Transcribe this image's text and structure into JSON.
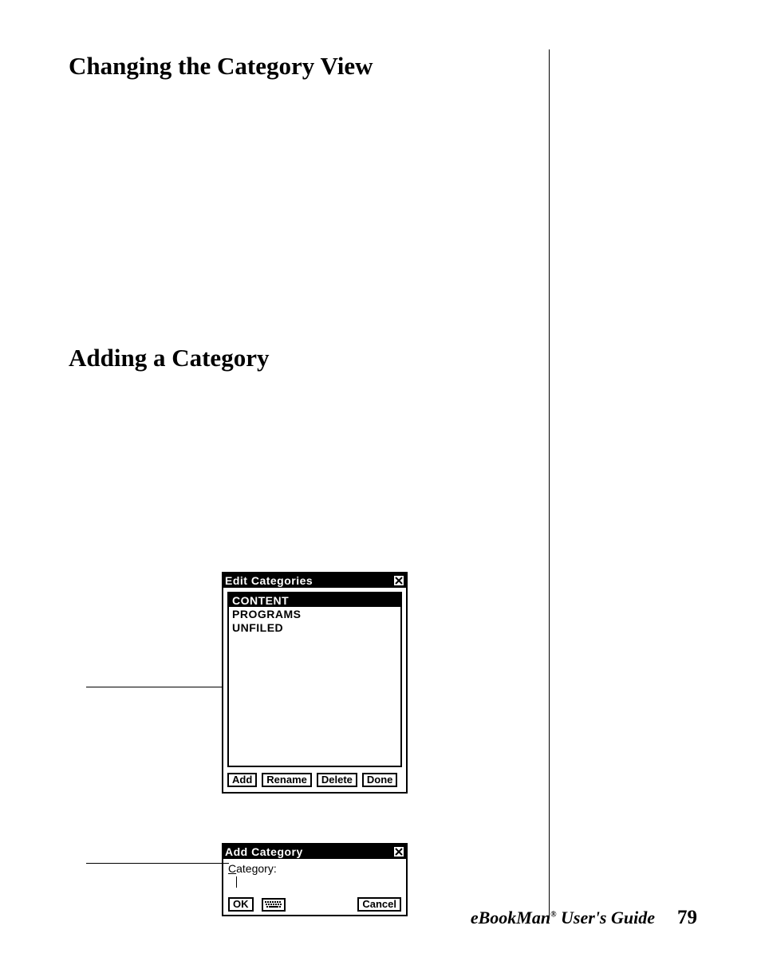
{
  "headings": {
    "changing": "Changing the Category View",
    "adding": "Adding a Category"
  },
  "editDialog": {
    "title": "Edit Categories",
    "items": [
      "CONTENT",
      "PROGRAMS",
      "UNFILED"
    ],
    "selectedIndex": 0,
    "buttons": {
      "add": "Add",
      "rename": "Rename",
      "delete": "Delete",
      "done": "Done"
    }
  },
  "addDialog": {
    "title": "Add Category",
    "fieldLabel_underlined": "C",
    "fieldLabel_rest": "ategory:",
    "buttons": {
      "ok": "OK",
      "cancel": "Cancel"
    }
  },
  "footer": {
    "guide_pre": "eBookMan",
    "guide_post": " User's Guide",
    "page": "79"
  }
}
